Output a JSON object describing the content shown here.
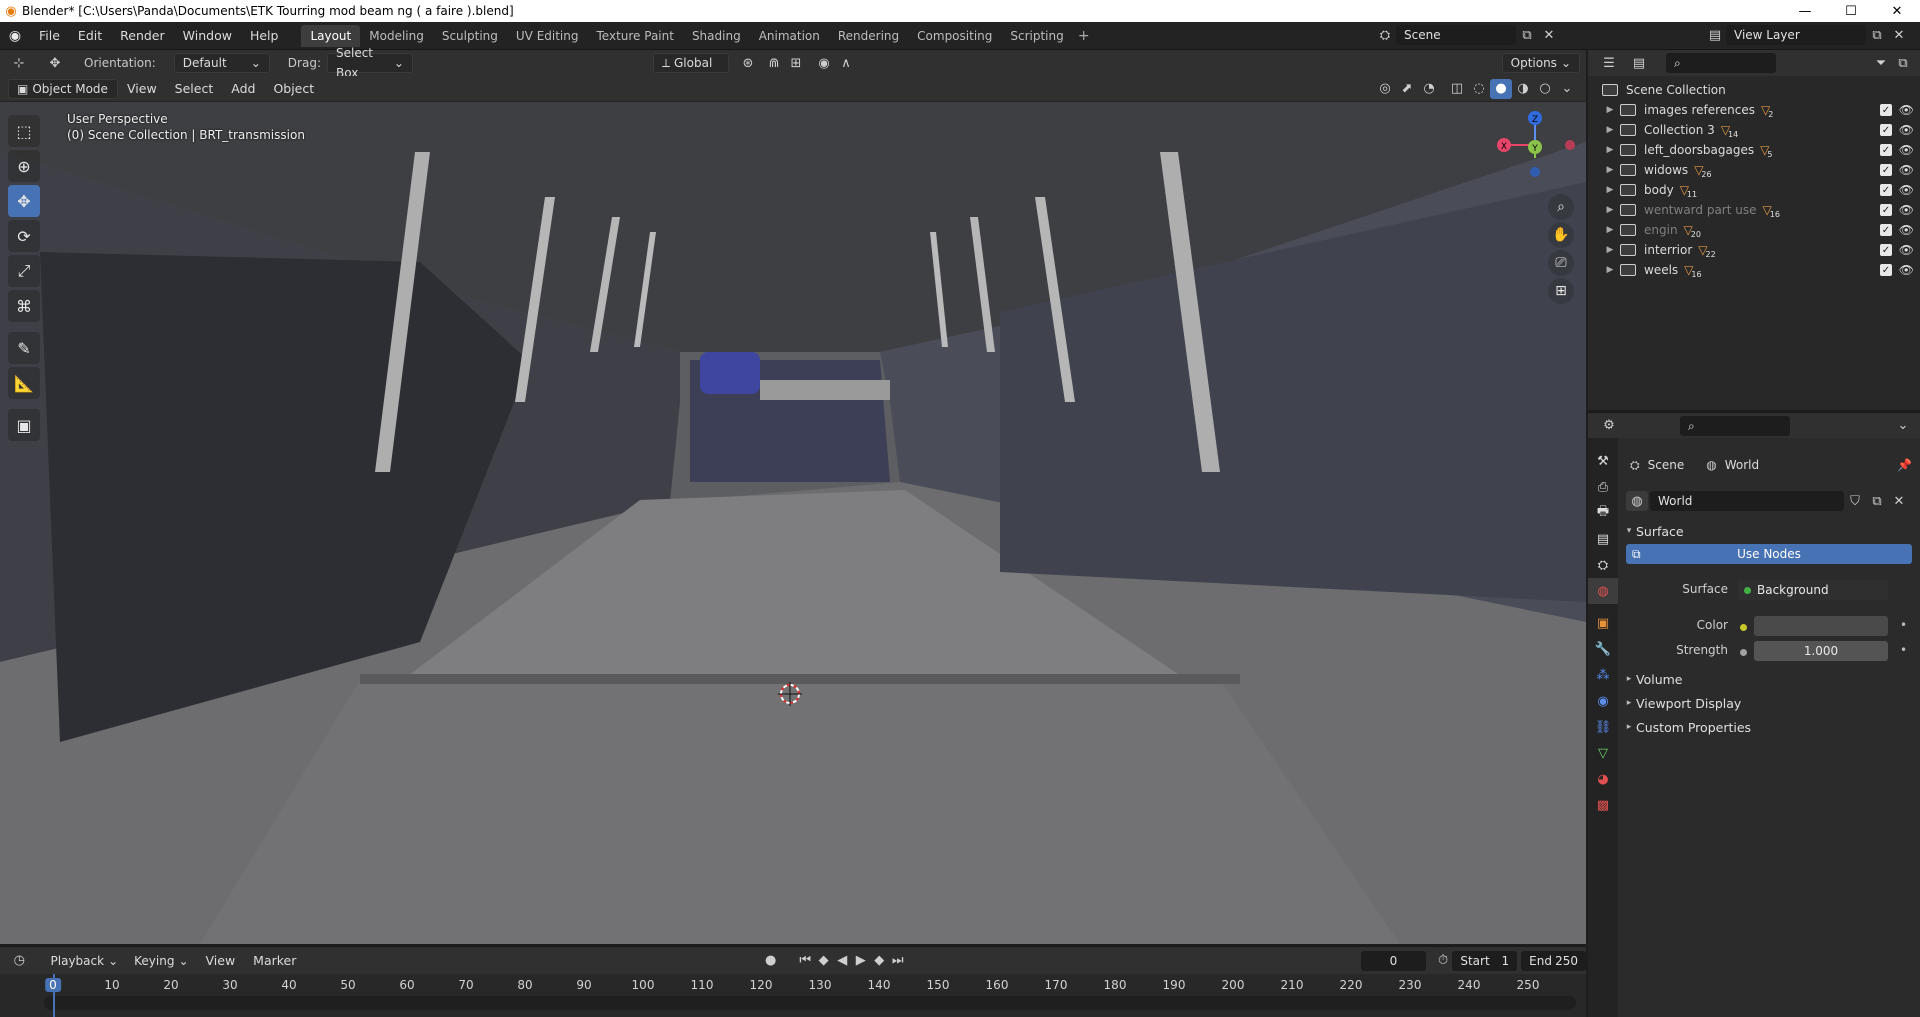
{
  "window": {
    "title": "Blender* [C:\\Users\\Panda\\Documents\\ETK Tourring mod beam ng ( a faire ).blend]",
    "controls": [
      "—",
      "☐",
      "✕"
    ]
  },
  "menu": [
    "File",
    "Edit",
    "Render",
    "Window",
    "Help"
  ],
  "workspaces": [
    "Layout",
    "Modeling",
    "Sculpting",
    "UV Editing",
    "Texture Paint",
    "Shading",
    "Animation",
    "Rendering",
    "Compositing",
    "Scripting"
  ],
  "active_workspace": "Layout",
  "scene": {
    "name": "Scene",
    "view_layer": "View Layer"
  },
  "viewport_header": {
    "orientation_label": "Orientation:",
    "orientation_value": "Default",
    "drag_label": "Drag:",
    "drag_value": "Select Box",
    "transform_orientation": "Global",
    "options": "Options",
    "mode": "Object Mode",
    "menus": [
      "View",
      "Select",
      "Add",
      "Object"
    ]
  },
  "viewport": {
    "perspective": "User Perspective",
    "collection_info": "(0) Scene Collection | BRT_transmission",
    "gizmo_axes": {
      "z": "Z",
      "x": "X",
      "y": "Y"
    }
  },
  "outliner": {
    "root": "Scene Collection",
    "items": [
      {
        "name": "images references",
        "count": "2",
        "dim": false
      },
      {
        "name": "Collection 3",
        "count": "14",
        "dim": false
      },
      {
        "name": "left_doorsbagages",
        "count": "5",
        "dim": false
      },
      {
        "name": "widows",
        "count": "26",
        "dim": false
      },
      {
        "name": "body",
        "count": "11",
        "dim": false
      },
      {
        "name": "wentward part use",
        "count": "16",
        "dim": true
      },
      {
        "name": "engin",
        "count": "20",
        "dim": true
      },
      {
        "name": "interrior",
        "count": "22",
        "dim": false
      },
      {
        "name": "weels",
        "count": "16",
        "dim": false
      }
    ]
  },
  "properties": {
    "breadcrumb_scene": "Scene",
    "breadcrumb_world": "World",
    "world_name": "World",
    "surface_panel": "Surface",
    "use_nodes": "Use Nodes",
    "surface_label": "Surface",
    "surface_value": "Background",
    "color_label": "Color",
    "strength_label": "Strength",
    "strength_value": "1.000",
    "collapsed_panels": [
      "Volume",
      "Viewport Display",
      "Custom Properties"
    ],
    "colors": {
      "world_color": "#4a4a4a",
      "accent": "#4772b3"
    }
  },
  "timeline": {
    "menus": [
      "Playback",
      "Keying",
      "View",
      "Marker"
    ],
    "current_frame": "0",
    "start_label": "Start",
    "start_value": "1",
    "end_label": "End",
    "end_value": "250",
    "ruler": [
      "0",
      "10",
      "20",
      "30",
      "40",
      "50",
      "60",
      "70",
      "80",
      "90",
      "100",
      "110",
      "120",
      "130",
      "140",
      "150",
      "160",
      "170",
      "180",
      "190",
      "200",
      "210",
      "220",
      "230",
      "240",
      "250"
    ]
  }
}
